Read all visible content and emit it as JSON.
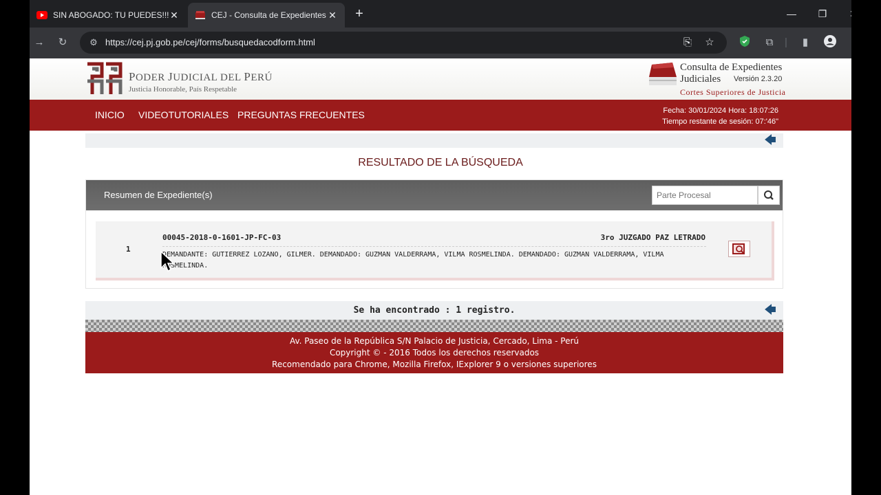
{
  "browser": {
    "tabs": [
      {
        "title": "SIN ABOGADO: TU PUEDES!!! - YouTube",
        "active": false,
        "icon": "youtube-icon"
      },
      {
        "title": "CEJ - Consulta de Expedientes Judiciales",
        "active": true,
        "icon": "cej-icon"
      }
    ],
    "url": "https://cej.pj.gob.pe/cej/forms/busquedacodform.html"
  },
  "header": {
    "pj_name_first": "P",
    "pj_name_rest": "ODER ",
    "pj_name_first2": "J",
    "pj_name_rest2": "UDICIAL DEL ",
    "pj_name_first3": "P",
    "pj_name_rest3": "ERÚ",
    "pj_slogan": "Justicia Honorable, País Respetable",
    "cej_title_line1": "Consulta de Expedientes",
    "cej_title_line2": "Judiciales",
    "cej_version": "Versión 2.3.20",
    "cej_cortes": "Cortes Superiores de Justicia"
  },
  "nav": {
    "items": [
      "INICIO",
      "VIDEOTUTORIALES",
      "PREGUNTAS FRECUENTES"
    ],
    "fecha": "Fecha: 30/01/2024 Hora: 18:07:26",
    "sesion": "Tiempo restante de sesión: 07:'46\""
  },
  "result": {
    "title": "RESULTADO DE LA BÚSQUEDA",
    "panel_label": "Resumen de Expediente(s)",
    "search_placeholder": "Parte Procesal",
    "rows": [
      {
        "num": "1",
        "code": "00045-2018-0-1601-JP-FC-03",
        "court": "3ro JUZGADO PAZ LETRADO",
        "parties": "DEMANDANTE: GUTIERREZ LOZANO, GILMER. DEMANDADO: GUZMAN VALDERRAMA, VILMA ROSMELINDA. DEMANDADO: GUZMAN VALDERRAMA, VILMA ROSMELINDA."
      }
    ],
    "found_label": "Se ha encontrado :  1  registro."
  },
  "footer": {
    "line1": "Av. Paseo de la República S/N Palacio de Justicia, Cercado, Lima - Perú",
    "line2": "Copyright © - 2016 Todos los derechos reservados",
    "line3": "Recomendado para Chrome, Mozilla Firefox, IExplorer 9 o versiones superiores"
  },
  "colors": {
    "brand_red": "#9b1b1b",
    "title_red": "#6a1b1b",
    "arrow_blue": "#1f4f7a"
  }
}
